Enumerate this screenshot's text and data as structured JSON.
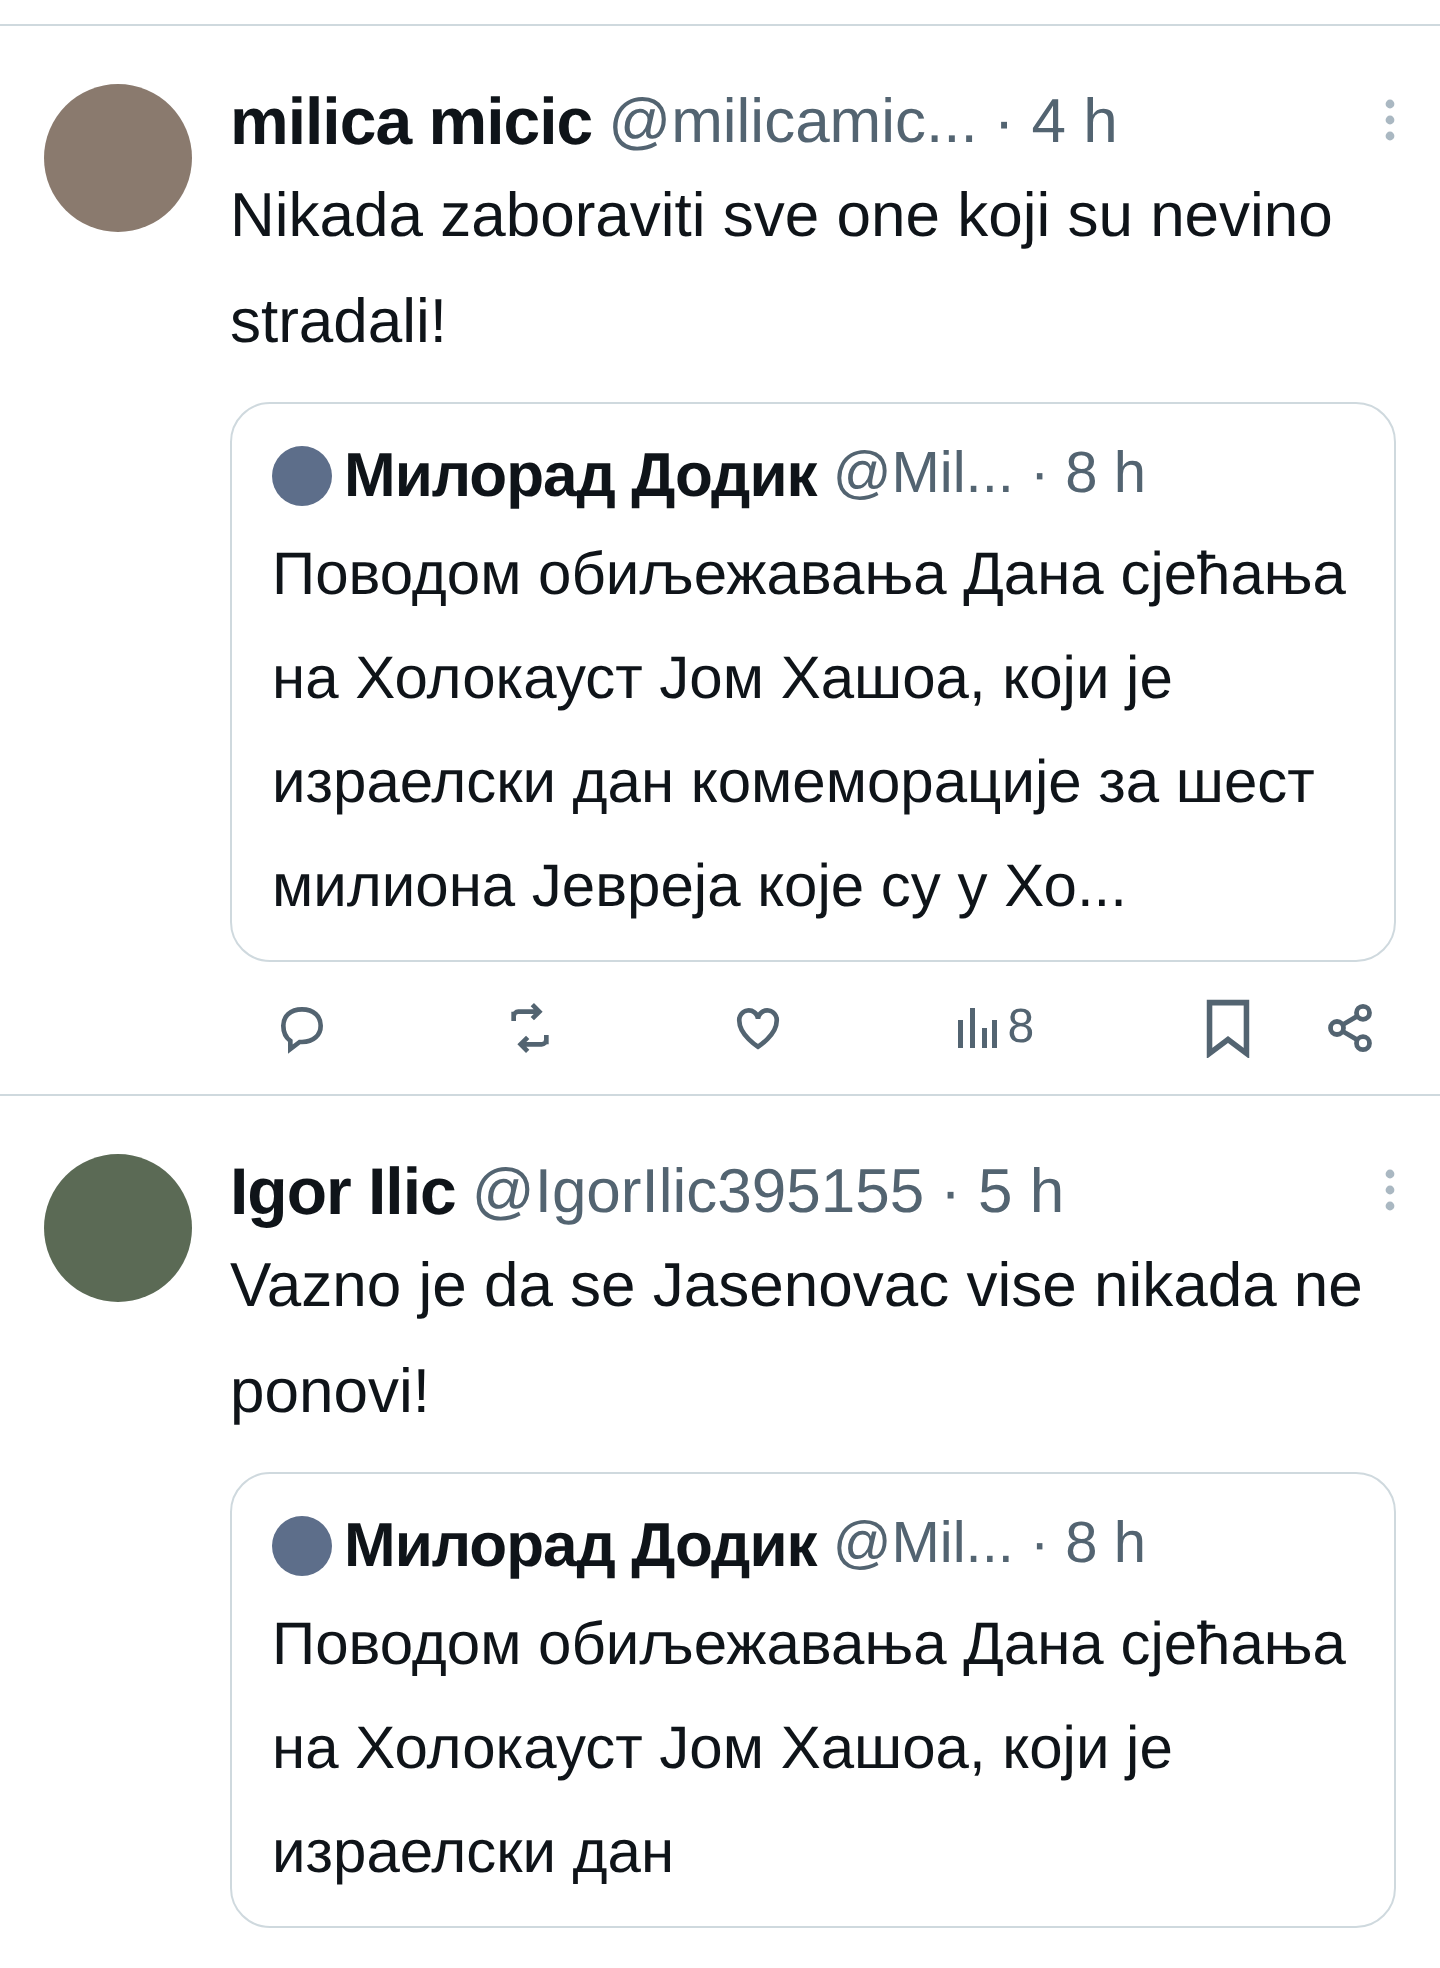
{
  "tweets": [
    {
      "name": "milica micic",
      "handle": "@milicamic...",
      "time": "· 4 h",
      "text": "Nikada zaboraviti sve one koji su nevino stradali!",
      "quote": {
        "name": "Милорад Додик",
        "handle": "@Mil...",
        "time": "· 8 h",
        "text": "Поводом обиљежавања Дана сјећања на Холокауст Јом Хашоа, који је израелски дан комеморације за шест милиона Јевреја које су у Хо..."
      },
      "actions": {
        "views": "8"
      }
    },
    {
      "name": "Igor Ilic",
      "handle": "@IgorIlic395155",
      "time": "· 5 h",
      "text": "Vazno je da se Jasenovac vise nikada ne ponovi!",
      "quote": {
        "name": "Милорад Додик",
        "handle": "@Mil...",
        "time": "· 8 h",
        "text": "Поводом обиљежавања Дана сјећања на Холокауст Јом Хашоа, који је израелски дан"
      }
    }
  ]
}
